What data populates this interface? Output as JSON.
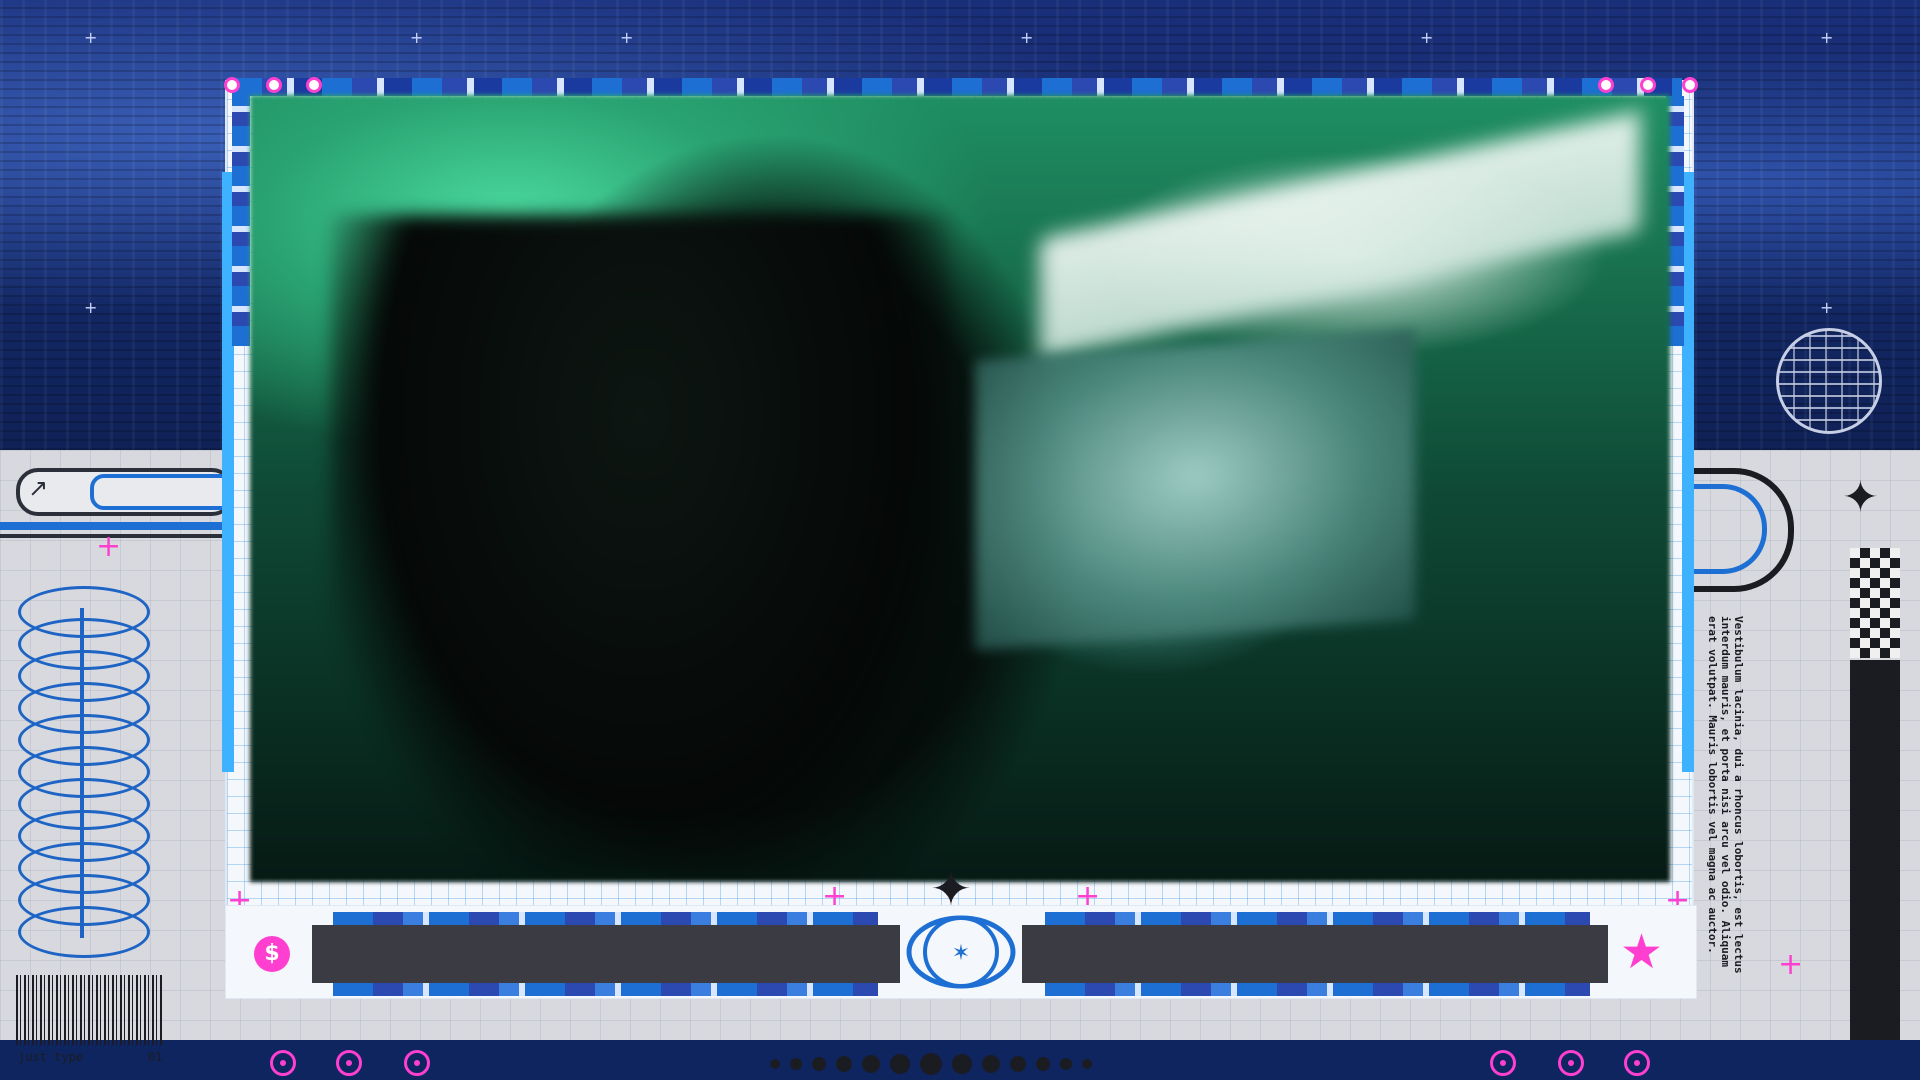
{
  "overlay": {
    "vertical_text": "Vestibulum lacinia, dui a rhoncus lobortis, est lectus interdum mauris, et porta nisi arcu vel odio. Aliquam erat volutpat. Mauris lobortis vel magna ac auctor.",
    "bottom_left_label": "just type",
    "bottom_left_number": "01",
    "dollar_symbol": "$",
    "star_symbol": "★",
    "accent_color": "#ff3fd0",
    "frame_blue": "#3fb2ff",
    "brand_blue": "#1e6fd4"
  }
}
